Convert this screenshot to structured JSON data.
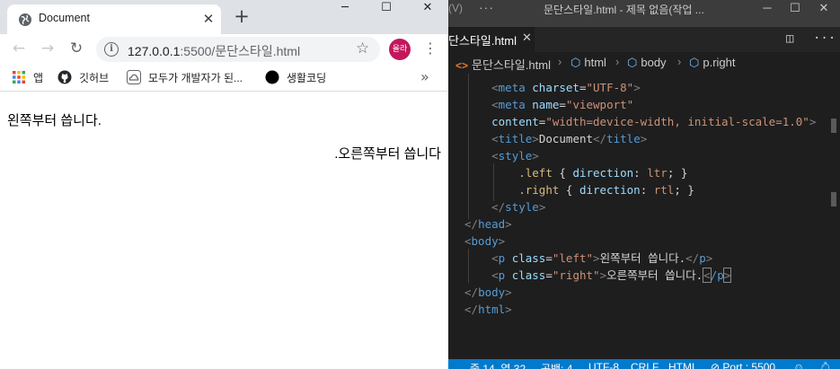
{
  "browser": {
    "tab": {
      "title": "Document",
      "close": "✕"
    },
    "new_tab": "+",
    "window_controls": {
      "minimize": "─",
      "maximize": "☐",
      "close": "✕"
    },
    "nav": {
      "back": "←",
      "forward": "→",
      "reload": "↻"
    },
    "address": {
      "host": "127.0.0.1",
      "path": ":5500/문단스타일.html"
    },
    "profile": {
      "label": "올라",
      "color": "#c2185b"
    },
    "bookmarks": [
      {
        "label": "앱",
        "icon": "apps-grid-icon"
      },
      {
        "label": "깃허브",
        "icon": "github-icon"
      },
      {
        "label": "모두가 개발자가 된...",
        "icon": "cloud-icon"
      },
      {
        "label": "생활코딩",
        "icon": "black-circle-icon"
      }
    ],
    "bookmarks_more": "»",
    "page": {
      "left_paragraph": "왼쪽부터 씁니다.",
      "right_paragraph": ".오른쪽부터 씁니다"
    }
  },
  "vscode": {
    "title_menu_fragment": "(V)",
    "title_menu_more": "···",
    "window_title": "문단스타일.html - 제목 없음(작업 ...",
    "window_controls": {
      "minimize": "─",
      "maximize": "☐",
      "close": "✕"
    },
    "tab": {
      "label": "단스타일.html",
      "close": "✕"
    },
    "actions": {
      "split": "◫",
      "more": "···"
    },
    "breadcrumbs": [
      "문단스타일.html",
      "html",
      "body",
      "p.right"
    ],
    "code": {
      "meta1": {
        "tag": "meta",
        "attr": "charset",
        "value": "\"UTF-8\""
      },
      "meta2": {
        "tag": "meta",
        "attr": "name",
        "value": "\"viewport\""
      },
      "content": {
        "attr": "content",
        "value": "\"width=device-width, initial-scale=1.0\""
      },
      "title": {
        "open": "title",
        "text": "Document",
        "close": "title"
      },
      "style_open": "style",
      "rule_left": {
        "selector": ".left",
        "prop": "direction",
        "value": "ltr"
      },
      "rule_right": {
        "selector": ".right",
        "prop": "direction",
        "value": "rtl"
      },
      "style_close": "style",
      "head_close": "head",
      "body_open": "body",
      "p_left": {
        "class": "\"left\"",
        "text": "왼쪽부터 씁니다."
      },
      "p_right": {
        "class": "\"right\"",
        "text": "오른쪽부터 씁니다."
      },
      "body_close": "body",
      "html_close": "html"
    },
    "status": {
      "position": "줄 14, 열 32",
      "spaces": "공백: 4",
      "encoding": "UTF-8",
      "eol": "CRLF",
      "language": "HTML",
      "port": "Port : 5500"
    }
  }
}
